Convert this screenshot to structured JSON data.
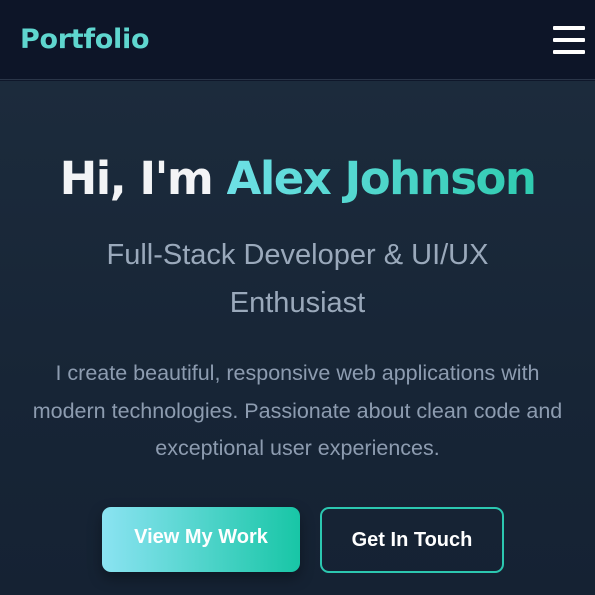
{
  "navbar": {
    "logo": "Portfolio",
    "menu_icon": "hamburger-menu-icon"
  },
  "hero": {
    "greeting": "Hi, I'm ",
    "name": "Alex Johnson",
    "subtitle": "Full-Stack Developer & UI/UX Enthusiast",
    "description": "I create beautiful, responsive web applications with modern technologies. Passionate about clean code and exceptional user experiences.",
    "primary_button": "View My Work",
    "secondary_button": "Get In Touch"
  },
  "colors": {
    "page_bg": "#0f172a",
    "navbar_bg": "#0d1528",
    "accent": "#2cc7b0",
    "accent_light": "#6ee0e6",
    "logo": "#5fd6cf",
    "heading": "#f3f4f6",
    "muted_text": "#9aa9bb"
  }
}
